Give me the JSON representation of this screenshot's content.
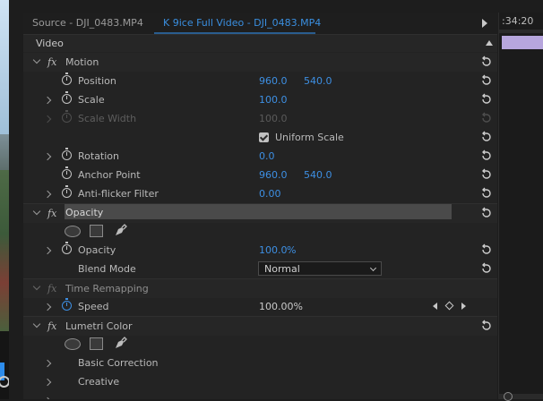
{
  "tabs": {
    "source": "Source - DJI_0483.MP4",
    "effect_controls": "K 9ice Full Video - DJI_0483.MP4"
  },
  "timeline": {
    "timecode": ":34:20"
  },
  "section": {
    "video_label": "Video"
  },
  "effects": {
    "motion": {
      "name": "Motion",
      "position": {
        "label": "Position",
        "x": "960.0",
        "y": "540.0"
      },
      "scale": {
        "label": "Scale",
        "value": "100.0"
      },
      "scale_width": {
        "label": "Scale Width",
        "value": "100.0"
      },
      "uniform_scale": {
        "label": "Uniform Scale",
        "checked": true
      },
      "rotation": {
        "label": "Rotation",
        "value": "0.0"
      },
      "anchor_point": {
        "label": "Anchor Point",
        "x": "960.0",
        "y": "540.0"
      },
      "anti_flicker": {
        "label": "Anti-flicker Filter",
        "value": "0.00"
      }
    },
    "opacity": {
      "name": "Opacity",
      "opacity": {
        "label": "Opacity",
        "value": "100.0",
        "unit": "%"
      },
      "blend_mode": {
        "label": "Blend Mode",
        "value": "Normal"
      }
    },
    "time_remapping": {
      "name": "Time Remapping",
      "speed": {
        "label": "Speed",
        "value": "100.00%"
      }
    },
    "lumetri": {
      "name": "Lumetri Color",
      "basic_correction": "Basic Correction",
      "creative": "Creative"
    }
  },
  "colors": {
    "accent": "#3d8fe3",
    "panel_bg": "#232323",
    "clip": "#b7a6dd",
    "selected_row": "#4a4a4a"
  }
}
